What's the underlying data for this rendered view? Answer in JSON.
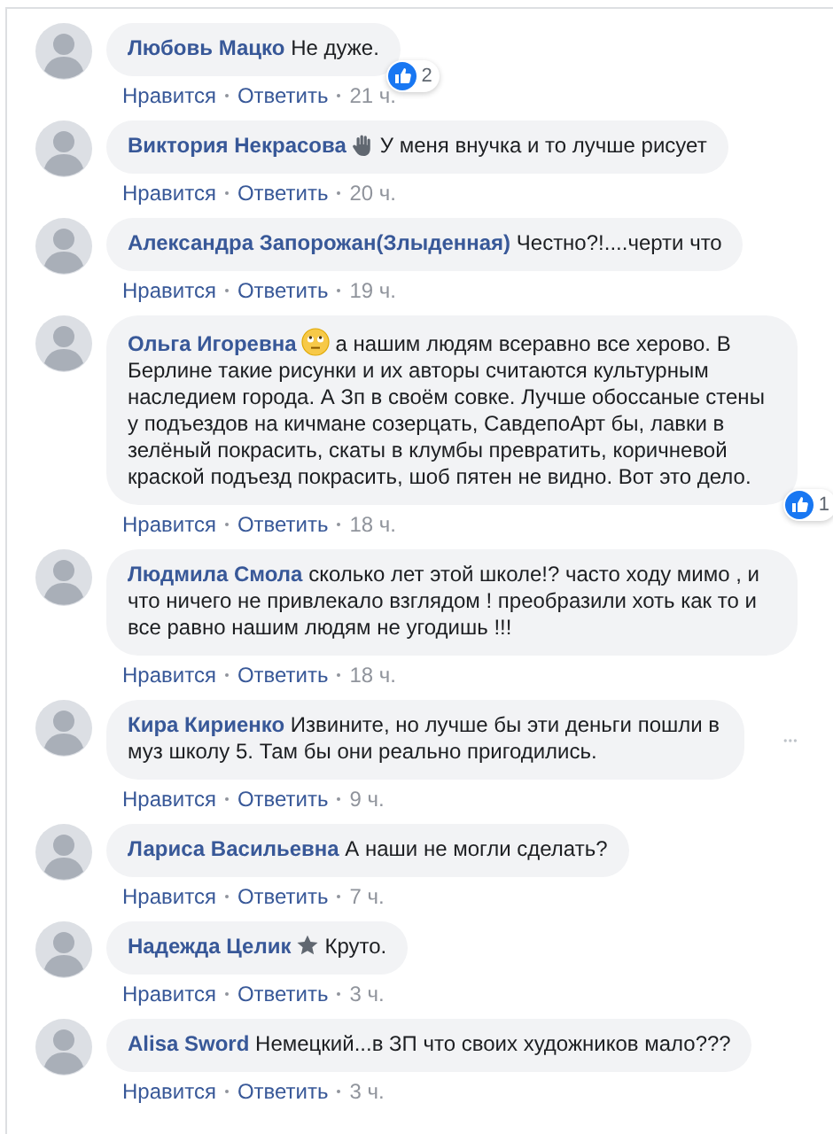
{
  "comments": [
    {
      "author": "Любовь Мацко",
      "kind": "plain",
      "text": "Не дуже.",
      "reaction": {
        "count": "2"
      },
      "more": false,
      "like": "Нравится",
      "reply": "Ответить",
      "time": "21 ч."
    },
    {
      "author": "Виктория Некрасова",
      "kind": "hand",
      "text": "У меня внучка и то лучше рисует",
      "more": false,
      "like": "Нравится",
      "reply": "Ответить",
      "time": "20 ч."
    },
    {
      "author": "Александра Запорожан(Злыденная)",
      "kind": "plain",
      "text": "Честно?!....черти что",
      "more": false,
      "like": "Нравится",
      "reply": "Ответить",
      "time": "19 ч."
    },
    {
      "author": "Ольга Игоревна",
      "kind": "emoji",
      "text": "а нашим людям всеравно все херово. В Берлине такие рисунки и их авторы считаются культурным наследием города. А Зп в своём совке. Лучше обоссаные стены у подъездов на кичмане созерцать, СавдепоАрт бы, лавки в зелёный покрасить, скаты в клумбы превратить, коричневой краской подъезд покрасить, шоб пятен не видно. Вот это дело.",
      "reaction": {
        "count": "1"
      },
      "more": false,
      "like": "Нравится",
      "reply": "Ответить",
      "time": "18 ч."
    },
    {
      "author": "Людмила Смола",
      "kind": "plain",
      "text": "сколько лет этой школе!? часто ходу мимо , и что ничего не привлекало взглядом ! преобразили хоть как то и все равно нашим людям не угодишь !!!",
      "more": false,
      "like": "Нравится",
      "reply": "Ответить",
      "time": "18 ч."
    },
    {
      "author": "Кира Кириенко",
      "kind": "plain",
      "text": "Извините, но лучше бы эти деньги пошли в муз школу 5. Там бы они реально пригодились.",
      "more": true,
      "like": "Нравится",
      "reply": "Ответить",
      "time": "9 ч."
    },
    {
      "author": "Лариса Васильевна",
      "kind": "plain",
      "text": "А наши не могли сделать?",
      "more": false,
      "like": "Нравится",
      "reply": "Ответить",
      "time": "7 ч."
    },
    {
      "author": "Надежда Целик",
      "kind": "star",
      "text": "Круто.",
      "more": false,
      "like": "Нравится",
      "reply": "Ответить",
      "time": "3 ч."
    },
    {
      "author": "Alisa Sword",
      "kind": "plain",
      "text": "Немецкий...в ЗП что своих художников мало???",
      "more": false,
      "like": "Нравится",
      "reply": "Ответить",
      "time": "3 ч."
    }
  ]
}
